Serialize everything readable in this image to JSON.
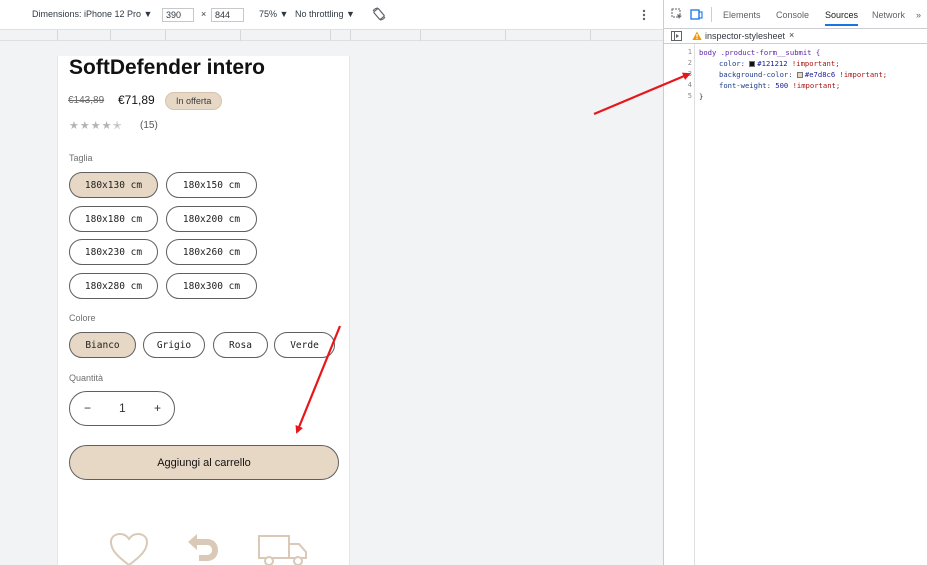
{
  "device_toolbar": {
    "dimensions_label": "Dimensions: iPhone 12 Pro ▼",
    "width": "390",
    "times": "×",
    "height": "844",
    "zoom": "75% ▼",
    "throttling": "No throttling ▼"
  },
  "product": {
    "title": "SoftDefender intero",
    "price_old": "€143,89",
    "price_new": "€71,89",
    "badge": "In offerta",
    "stars": "★★★★✭",
    "reviews": "(15)",
    "size_label": "Taglia",
    "sizes": [
      "180x130 cm",
      "180x150 cm",
      "180x180 cm",
      "180x200 cm",
      "180x230 cm",
      "180x260 cm",
      "180x280 cm",
      "180x300 cm"
    ],
    "color_label": "Colore",
    "colors": [
      "Bianco",
      "Grigio",
      "Rosa",
      "Verde"
    ],
    "quantity_label": "Quantità",
    "qty_minus": "−",
    "qty_value": "1",
    "qty_plus": "+",
    "add_to_cart": "Aggiungi al carrello",
    "footer_icons": [
      "heart-icon",
      "return-arrow-icon",
      "truck-icon"
    ]
  },
  "devtools": {
    "tabs": [
      "Elements",
      "Console",
      "Sources",
      "Network",
      "»"
    ],
    "active_tab": "Sources",
    "file_name": "inspector-stylesheet",
    "file_close": "×",
    "line_numbers": [
      "1",
      "2",
      "3",
      "4",
      "5"
    ],
    "code": {
      "selector": "body .product-form__submit {",
      "color_prop": "color:",
      "color_value": "#121212",
      "bg_prop": "background-color:",
      "bg_value": "#e7d8c6",
      "weight_prop": "font-weight:",
      "weight_value": "500",
      "important": "!important;",
      "close": "}"
    }
  },
  "colors": {
    "accent": "#e7d8c6",
    "text": "#121212",
    "arrow": "#e8161b",
    "devtools_blue": "#1a73e8"
  }
}
